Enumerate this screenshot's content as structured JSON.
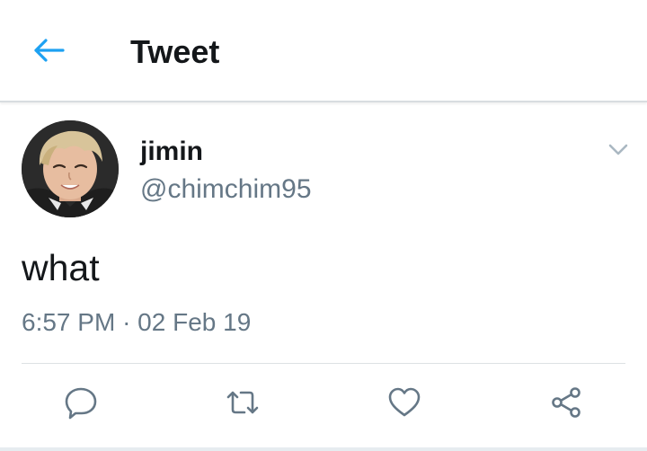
{
  "header": {
    "title": "Tweet",
    "back_icon": "back-arrow-icon",
    "accent_color": "#1da1f2"
  },
  "tweet": {
    "author": {
      "name": "jimin",
      "handle": "@chimchim95",
      "avatar_icon": "profile-photo"
    },
    "text": "what",
    "time": "6:57 PM",
    "separator": "·",
    "date": "02 Feb 19",
    "menu_icon": "chevron-down-icon"
  },
  "actions": [
    {
      "name": "reply",
      "icon": "reply-icon"
    },
    {
      "name": "retweet",
      "icon": "retweet-icon"
    },
    {
      "name": "like",
      "icon": "heart-icon"
    },
    {
      "name": "share",
      "icon": "share-icon"
    }
  ],
  "colors": {
    "primary_text": "#14171a",
    "secondary_text": "#657786",
    "icon_gray": "#657786"
  }
}
